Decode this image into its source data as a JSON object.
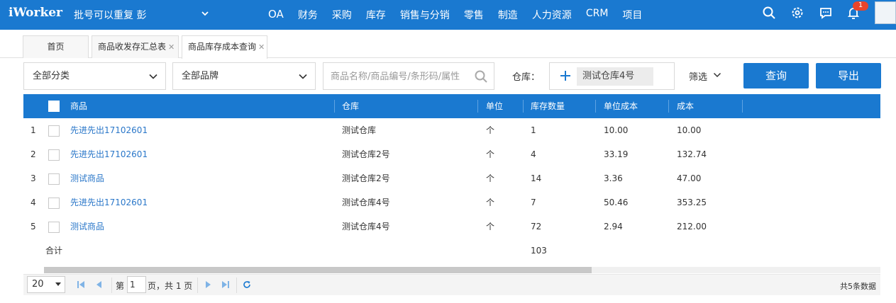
{
  "topbar": {
    "logo": "iWorker",
    "company": "批号可以重复 彭",
    "nav": [
      "OA",
      "财务",
      "采购",
      "库存",
      "销售与分销",
      "零售",
      "制造",
      "人力资源",
      "CRM",
      "项目"
    ],
    "icons": [
      "search-icon",
      "gear-icon",
      "chat-icon",
      "bell-icon"
    ],
    "notification_count": "1"
  },
  "tabs": [
    {
      "label": "首页",
      "closable": false
    },
    {
      "label": "商品收发存汇总表",
      "closable": true
    },
    {
      "label": "商品库存成本查询",
      "closable": true,
      "active": true
    }
  ],
  "filters": {
    "category": "全部分类",
    "brand": "全部品牌",
    "search_placeholder": "商品名称/商品编号/条形码/属性",
    "warehouse_label": "仓库：",
    "warehouse_selected": "测试仓库4号",
    "filter_label": "筛选",
    "query_button": "查询",
    "export_button": "导出"
  },
  "table": {
    "columns": [
      "商品",
      "仓库",
      "单位",
      "库存数量",
      "单位成本",
      "成本"
    ],
    "rows": [
      {
        "no": "1",
        "product": "先进先出17102601",
        "warehouse": "测试仓库",
        "unit": "个",
        "qty": "1",
        "unit_cost": "10.00",
        "cost": "10.00"
      },
      {
        "no": "2",
        "product": "先进先出17102601",
        "warehouse": "测试仓库2号",
        "unit": "个",
        "qty": "4",
        "unit_cost": "33.19",
        "cost": "132.74"
      },
      {
        "no": "3",
        "product": "测试商品",
        "warehouse": "测试仓库2号",
        "unit": "个",
        "qty": "14",
        "unit_cost": "3.36",
        "cost": "47.00"
      },
      {
        "no": "4",
        "product": "先进先出17102601",
        "warehouse": "测试仓库4号",
        "unit": "个",
        "qty": "7",
        "unit_cost": "50.46",
        "cost": "353.25"
      },
      {
        "no": "5",
        "product": "测试商品",
        "warehouse": "测试仓库4号",
        "unit": "个",
        "qty": "72",
        "unit_cost": "2.94",
        "cost": "212.00"
      }
    ],
    "total_label": "合计",
    "total_qty": "103"
  },
  "pager": {
    "page_size": "20",
    "page_prefix": "第",
    "page_value": "1",
    "page_suffix": "页，共 1 页",
    "total_text": "共5条数据"
  },
  "colors": {
    "brand": "#1a79d0",
    "link": "#2a77c9",
    "badge": "#e8452c"
  }
}
